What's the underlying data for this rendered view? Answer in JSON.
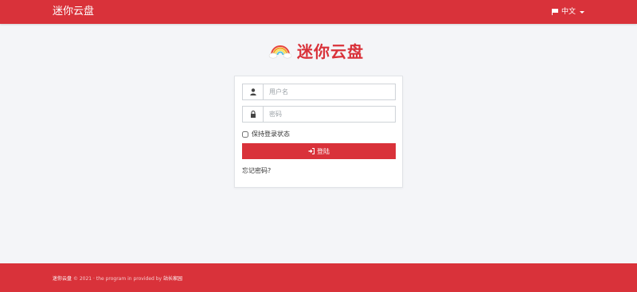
{
  "header": {
    "brand": "迷你云盘",
    "language": "中文"
  },
  "logo": {
    "text": "迷你云盘"
  },
  "login_form": {
    "username_placeholder": "用户名",
    "password_placeholder": "密码",
    "remember_label": "保持登录状态",
    "submit_label": "登陆",
    "forgot_link": "忘记密码?"
  },
  "footer": {
    "brand": "迷你云盘",
    "text": "© 2021 · the program in provided by",
    "link": "站长家园"
  },
  "colors": {
    "accent": "#d9323a",
    "background": "#f4f5f8"
  }
}
